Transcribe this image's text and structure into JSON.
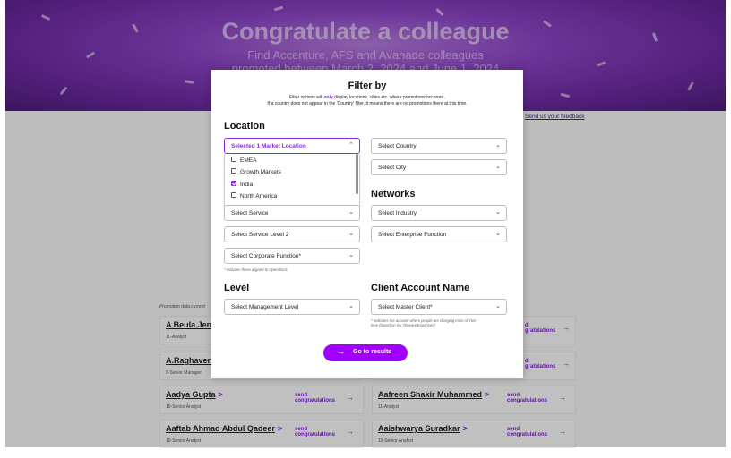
{
  "hero": {
    "title": "Congratulate a colleague",
    "subtitle_line1": "Find Accenture, AFS and Avanade colleagues",
    "subtitle_line2": "promoted between March 2, 2024 and June 1, 2024"
  },
  "feedback_link": "Send us your feedback",
  "promotion_note": "Promotion data current",
  "cards": [
    {
      "name": "A Beula Jenif",
      "role": "11-Analyst",
      "cta": [
        "send",
        "congratulations"
      ]
    },
    {
      "name": "A.Raghavend",
      "role": "6-Senior Manager",
      "cta": [
        "send",
        "congratulations"
      ]
    },
    {
      "name": "Aadya Gupta",
      "role": "10-Senior Analyst",
      "cta": [
        "send",
        "congratulations"
      ]
    },
    {
      "name": "Aafreen Shakir Muhammed",
      "role": "11-Analyst",
      "cta": [
        "send",
        "congratulations"
      ]
    },
    {
      "name": "Aaftab Ahmad Abdul Qadeer",
      "role": "10-Senior Analyst",
      "cta": [
        "send",
        "congratulations"
      ]
    },
    {
      "name": "Aaishwarya Suradkar",
      "role": "10-Senior Analyst",
      "cta": [
        "send",
        "congratulations"
      ]
    }
  ],
  "right_cards": [
    {
      "cta": [
        "d",
        "gratulations"
      ]
    },
    {
      "cta": [
        "d",
        "gratulations"
      ]
    }
  ],
  "modal": {
    "title": "Filter by",
    "desc_pre": "Filter options will ",
    "desc_hl": "only",
    "desc_post": " display locations, cities etc. where promotions occurred.",
    "desc_line2": "If a country does not appear in the 'Country' filter, it means there are no promotions there at this time.",
    "sections": {
      "location": "Location",
      "networks": "Networks",
      "level": "Level",
      "client": "Client Account Name"
    },
    "selects": {
      "market_location": "Selected 1 Market Location",
      "country": "Select Country",
      "city": "Select City",
      "service": "Select Service",
      "industry": "Select Industry",
      "service_level2": "Select Service Level 2",
      "enterprise_function": "Select Enterprise Function",
      "corporate_function": "Select Corporate Function*",
      "management_level": "Select Management Level",
      "master_client": "Select Master Client*"
    },
    "market_options": [
      {
        "label": "EMEA",
        "checked": false
      },
      {
        "label": "Growth Markets",
        "checked": false
      },
      {
        "label": "India",
        "checked": true
      },
      {
        "label": "North America",
        "checked": false
      }
    ],
    "corporate_note": "* Includes those aligned to Operations",
    "client_note_line1": "* Indicates the account where people are charging most of their",
    "client_note_line2": "time (based on my TimeandExpenses)",
    "go_button": "Go to results",
    "accent_color": "#a100ff"
  }
}
